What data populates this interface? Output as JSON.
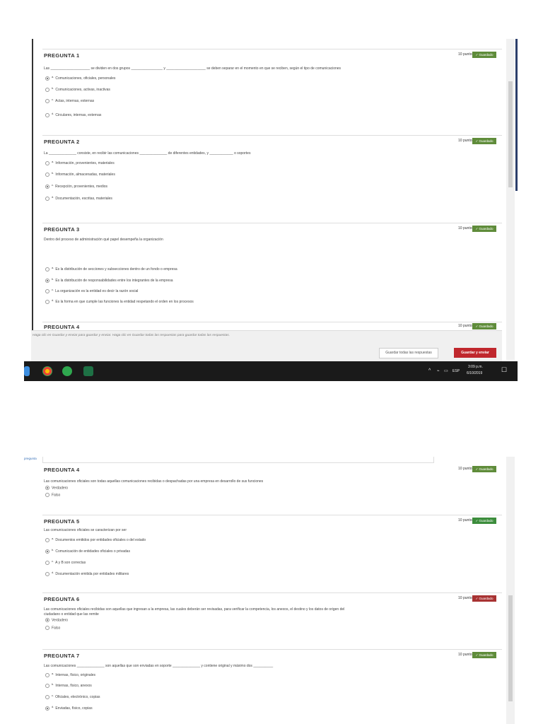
{
  "common": {
    "points": "10 puntos",
    "saved": "Guardado"
  },
  "shot1": {
    "questions": [
      {
        "title": "PREGUNTA 1",
        "prompt": "Las ____________________ se dividen en dos grupos ________________ y ____________________ se deben separar en el momento en que se reciben, según el tipo de comunicaciones",
        "options": [
          {
            "letter": "a.",
            "text": "Comunicaciones, oficiales, personales",
            "selected": true
          },
          {
            "letter": "b.",
            "text": "Comunicaciones, activas, inactivas",
            "selected": false
          },
          {
            "letter": "c.",
            "text": "Actas, internas, externas",
            "selected": false
          },
          {
            "letter": "d.",
            "text": "Circulares, internas, externas",
            "selected": false
          }
        ]
      },
      {
        "title": "PREGUNTA 2",
        "prompt": "La ______________ consiste, en recibir las comunicaciones ______________ de diferentes entidades, y ____________ o soportes",
        "options": [
          {
            "letter": "a.",
            "text": "Información, provenientes, materiales",
            "selected": false
          },
          {
            "letter": "b.",
            "text": "Información, almacenadas, materiales",
            "selected": false
          },
          {
            "letter": "c.",
            "text": "Recepción, provenientes, medios",
            "selected": true
          },
          {
            "letter": "d.",
            "text": "Documentación, escritas, materiales",
            "selected": false
          }
        ]
      },
      {
        "title": "PREGUNTA 3",
        "prompt": "Dentro del proceso de administración qué papel desempeña la organización",
        "options": [
          {
            "letter": "a.",
            "text": "Es la distribución de secciones y subsecciones dentro de un fondo o empresa",
            "selected": false
          },
          {
            "letter": "b.",
            "text": "Es la distribución de responsabilidades entre los integrantes de la empresa",
            "selected": true
          },
          {
            "letter": "c.",
            "text": "La organización es la entidad es decir la razón social",
            "selected": false
          },
          {
            "letter": "d.",
            "text": "Es la forma en que cumple las funciones la entidad respetando el orden en los procesos",
            "selected": false
          }
        ]
      },
      {
        "title": "PREGUNTA 4",
        "prompt": "",
        "options": []
      }
    ],
    "footer": {
      "hint": "Haga clic en Guardar y enviar para guardar y enviar. Haga clic en Guardar todas las respuestas para guardar todas las respuestas.",
      "save_all": "Guardar todas las respuestas",
      "save_submit": "Guardar y enviar"
    },
    "taskbar": {
      "lang": "ESP",
      "time": "3:09 p.m.",
      "date": "6/10/2019"
    }
  },
  "shot2": {
    "top_link": "pregunta",
    "questions": [
      {
        "title": "PREGUNTA 4",
        "prompt": "Las comunicaciones oficiales son todas aquellas comunicaciones recibidas o despachadas por una empresa en desarrollo de sus funciones",
        "options": [
          {
            "letter": "",
            "text": "Verdadero",
            "selected": true
          },
          {
            "letter": "",
            "text": "Falso",
            "selected": false
          }
        ]
      },
      {
        "title": "PREGUNTA 5",
        "prompt": "Las comunicaciones oficiales se caracterizan por ser",
        "options": [
          {
            "letter": "a.",
            "text": "Documentos emitidos por entidades oficiales o del estado",
            "selected": false
          },
          {
            "letter": "b.",
            "text": "Comunicación de entidades oficiales o privadas",
            "selected": true
          },
          {
            "letter": "c.",
            "text": "A y B son correctas",
            "selected": false
          },
          {
            "letter": "d.",
            "text": "Documentación emitida por entidades militares",
            "selected": false
          }
        ]
      },
      {
        "title": "PREGUNTA 6",
        "prompt": "Las comunicaciones oficiales recibidas son aquellas que ingresan a la empresa, las cuales deberán ser revisadas, para verificar la competencia, los anexos, el destino y los datos de origen del",
        "prompt2": "ciudadano o entidad que las remite",
        "options": [
          {
            "letter": "",
            "text": "Verdadero",
            "selected": true
          },
          {
            "letter": "",
            "text": "Falso",
            "selected": false
          }
        ]
      },
      {
        "title": "PREGUNTA 7",
        "prompt": "Las comunicaciones ______________ son aquellas que son enviadas en soporte ______________ y contiene original y máximo dos __________",
        "options": [
          {
            "letter": "a.",
            "text": "Internas, físico, originales",
            "selected": false
          },
          {
            "letter": "b.",
            "text": "Internas, físico, anexos",
            "selected": false
          },
          {
            "letter": "c.",
            "text": "Oficiales, electrónico, copias",
            "selected": false
          },
          {
            "letter": "d.",
            "text": "Enviadas, físico, copias",
            "selected": true
          }
        ]
      }
    ]
  }
}
